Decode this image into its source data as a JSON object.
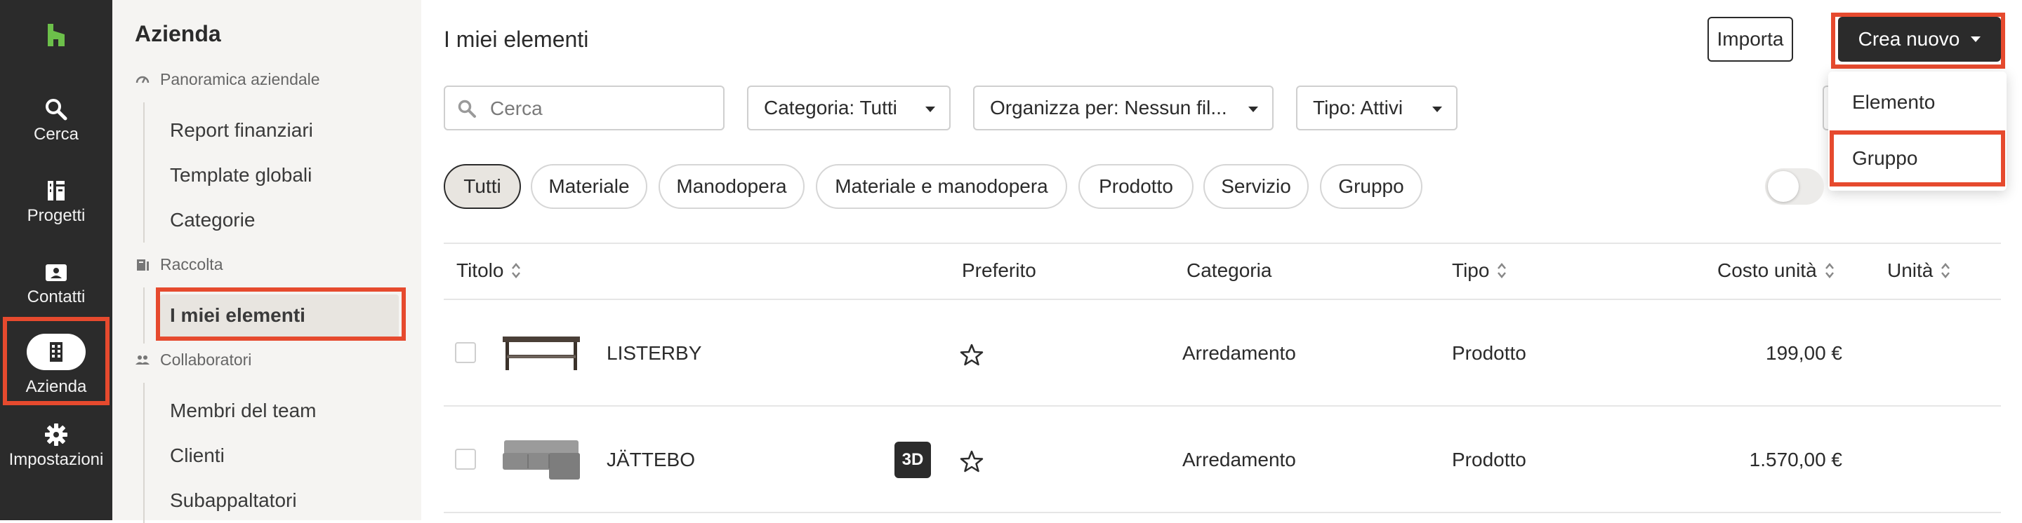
{
  "rail": {
    "items": [
      {
        "label": "Cerca",
        "icon": "search-icon"
      },
      {
        "label": "Progetti",
        "icon": "projects-icon"
      },
      {
        "label": "Contatti",
        "icon": "contacts-icon"
      },
      {
        "label": "Azienda",
        "icon": "building-icon",
        "active": true
      },
      {
        "label": "Impostazioni",
        "icon": "gear-icon"
      }
    ]
  },
  "subnav": {
    "title": "Azienda",
    "section_overview": "Panoramica aziendale",
    "items_overview": [
      "Report finanziari",
      "Template globali",
      "Categorie"
    ],
    "section_collection": "Raccolta",
    "items_collection": [
      "I miei elementi"
    ],
    "section_collaborators": "Collaboratori",
    "items_collaborators": [
      "Membri del team",
      "Clienti",
      "Subappaltatori"
    ]
  },
  "main": {
    "title": "I miei elementi",
    "import_label": "Importa",
    "create_label": "Crea nuovo",
    "create_menu": [
      "Elemento",
      "Gruppo"
    ],
    "search_placeholder": "Cerca",
    "filters": {
      "category": "Categoria: Tutti",
      "organize": "Organizza per: Nessun fil...",
      "type": "Tipo: Attivi"
    },
    "chips": [
      "Tutti",
      "Materiale",
      "Manodopera",
      "Materiale e manodopera",
      "Prodotto",
      "Servizio",
      "Gruppo"
    ],
    "columns": {
      "title": "Titolo",
      "favorite": "Preferito",
      "category": "Categoria",
      "type": "Tipo",
      "unit_cost": "Costo unità",
      "unit": "Unità"
    },
    "rows": [
      {
        "title": "LISTERBY",
        "category": "Arredamento",
        "type": "Prodotto",
        "cost": "199,00 €",
        "badge": ""
      },
      {
        "title": "JÄTTEBO",
        "category": "Arredamento",
        "type": "Prodotto",
        "cost": "1.570,00 €",
        "badge": "3D"
      }
    ]
  },
  "colors": {
    "accent_green": "#6cc04a",
    "highlight_red": "#e64a2e",
    "dark": "#2b2b2b"
  }
}
